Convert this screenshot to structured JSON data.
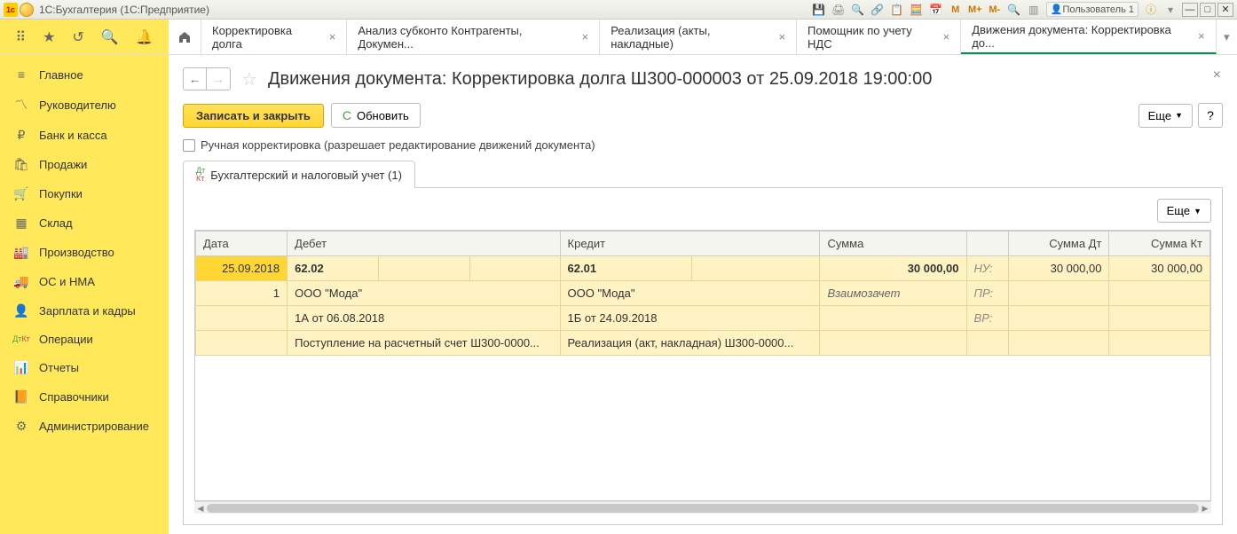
{
  "titlebar": {
    "app_name": "1С:Бухгалтерия  (1С:Предприятие)",
    "m_labels": [
      "M",
      "M+",
      "M-"
    ],
    "user_label": "Пользователь 1"
  },
  "tabs": [
    {
      "label": "Корректировка долга"
    },
    {
      "label": "Анализ субконто Контрагенты, Докумен..."
    },
    {
      "label": "Реализация (акты, накладные)"
    },
    {
      "label": "Помощник по учету НДС"
    },
    {
      "label": "Движения документа: Корректировка до..."
    }
  ],
  "sidebar": [
    {
      "icon": "≡",
      "label": "Главное"
    },
    {
      "icon": "📈",
      "label": "Руководителю"
    },
    {
      "icon": "₽",
      "label": "Банк и касса"
    },
    {
      "icon": "🛍",
      "label": "Продажи"
    },
    {
      "icon": "🛒",
      "label": "Покупки"
    },
    {
      "icon": "▦",
      "label": "Склад"
    },
    {
      "icon": "🏭",
      "label": "Производство"
    },
    {
      "icon": "🚚",
      "label": "ОС и НМА"
    },
    {
      "icon": "👤",
      "label": "Зарплата и кадры"
    },
    {
      "icon": "ДтКт",
      "label": "Операции"
    },
    {
      "icon": "📊",
      "label": "Отчеты"
    },
    {
      "icon": "📙",
      "label": "Справочники"
    },
    {
      "icon": "⚙",
      "label": "Администрирование"
    }
  ],
  "page": {
    "title": "Движения документа: Корректировка долга Ш300-000003 от 25.09.2018 19:00:00",
    "btn_save": "Записать и закрыть",
    "btn_refresh": "Обновить",
    "btn_more": "Еще",
    "btn_help": "?",
    "checkbox_label": "Ручная корректировка (разрешает редактирование движений документа)",
    "subtab_label": "Бухгалтерский и налоговый учет (1)"
  },
  "table": {
    "headers": {
      "date": "Дата",
      "debit": "Дебет",
      "credit": "Кредит",
      "sum": "Сумма",
      "sum_dt": "Сумма Дт",
      "sum_kt": "Сумма Кт"
    },
    "sidecol": {
      "nu": "НУ:",
      "pr": "ПР:",
      "vr": "ВР:"
    },
    "rows": {
      "date": "25.09.2018",
      "num": "1",
      "debit_acc": "62.02",
      "credit_acc": "62.01",
      "sum": "30 000,00",
      "sum_dt": "30 000,00",
      "sum_kt": "30 000,00",
      "debit_sub1": "ООО \"Мода\"",
      "credit_sub1": "ООО \"Мода\"",
      "comment": "Взаимозачет",
      "debit_sub2": "1А от 06.08.2018",
      "credit_sub2": "1Б от 24.09.2018",
      "debit_sub3": "Поступление на расчетный счет Ш300-0000...",
      "credit_sub3": "Реализация (акт, накладная) Ш300-0000..."
    }
  }
}
